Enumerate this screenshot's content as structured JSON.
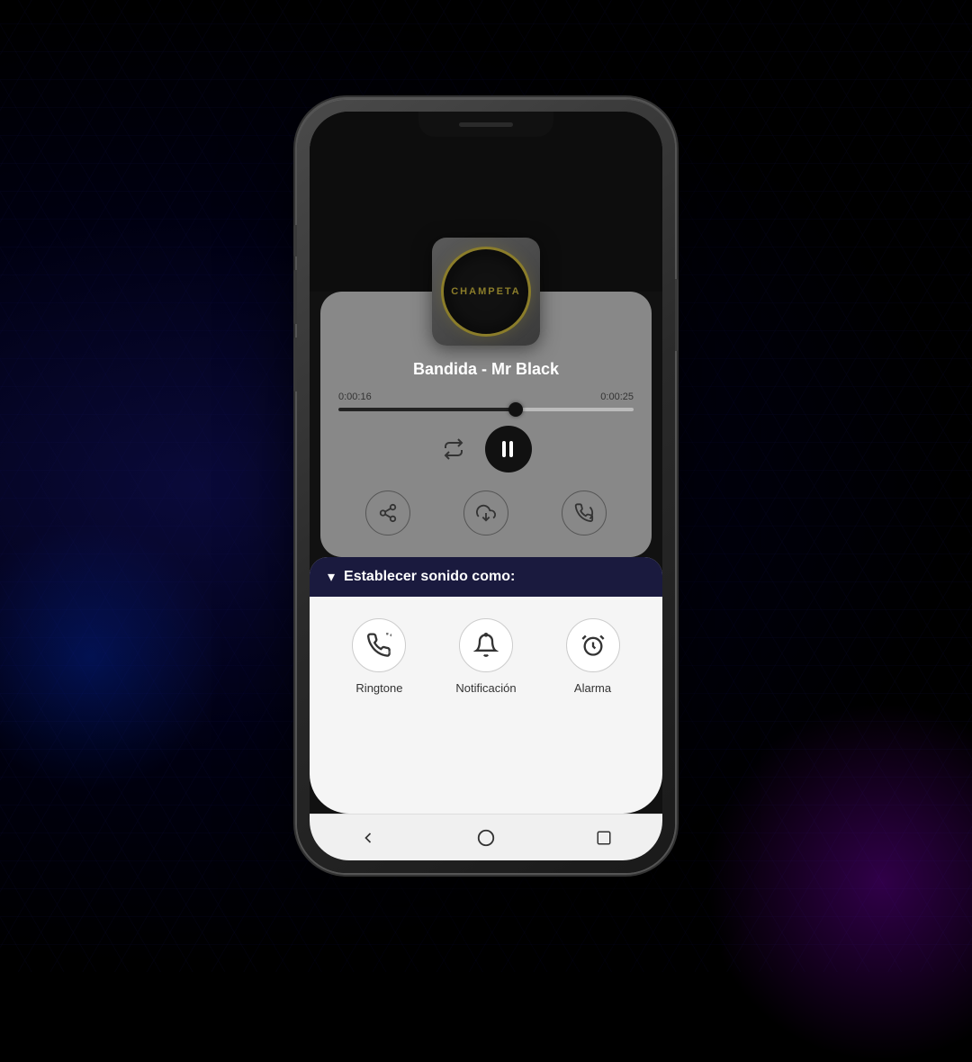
{
  "background": {
    "color": "#000010"
  },
  "phone": {
    "album": {
      "label": "CHAMPETA"
    },
    "player": {
      "song_title": "Bandida - Mr Black",
      "time_current": "0:00:16",
      "time_total": "0:00:25",
      "progress_percent": 64
    },
    "action_buttons": {
      "share_label": "share",
      "download_label": "download",
      "ringtone_set_label": "set ringtone"
    },
    "bottom_sheet": {
      "header": "Establecer sonido como:",
      "chevron": "▾",
      "options": [
        {
          "id": "ringtone",
          "label": "Ringtone",
          "icon": "phone-ring"
        },
        {
          "id": "notification",
          "label": "Notificación",
          "icon": "bell"
        },
        {
          "id": "alarm",
          "label": "Alarma",
          "icon": "alarm-clock"
        }
      ]
    },
    "nav_bar": {
      "back_label": "back",
      "home_label": "home",
      "recent_label": "recent"
    }
  }
}
